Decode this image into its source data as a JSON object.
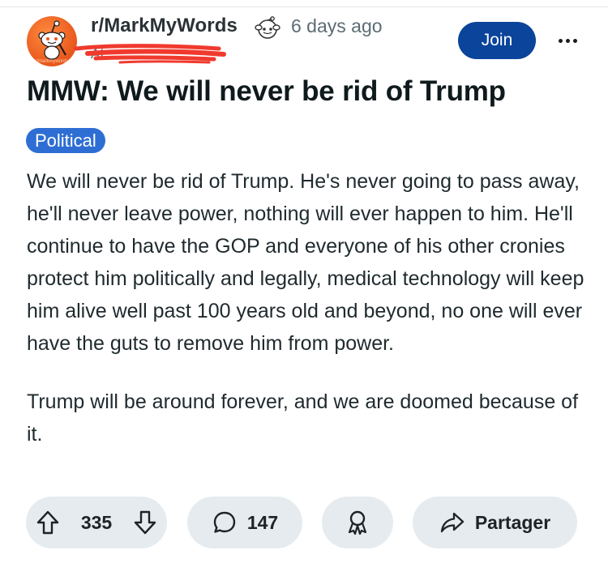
{
  "post": {
    "subreddit": "r/MarkMyWords",
    "time_ago": "6 days ago",
    "author_redacted": "AI",
    "title": "MMW: We will never be rid of Trump",
    "flair": "Political",
    "body": [
      "We will never be rid of Trump. He's never going to pass away, he'll never leave power, nothing will ever happen to him. He'll continue to have the GOP and everyone of his other cronies protect him politically and legally, medical technology will keep him alive well past 100 years old and beyond, no one will ever have the guts to remove him from power.",
      "Trump will be around forever, and we are doomed because of it."
    ]
  },
  "header": {
    "join_label": "Join",
    "avatar_caption": "r/markmywords"
  },
  "actions": {
    "upvotes": "335",
    "comments": "147",
    "share_label": "Partager"
  },
  "colors": {
    "join_bg": "#0a449b",
    "flair_bg": "#2e6ed4",
    "pill_bg": "#e5ebee",
    "avatar_orange": "#e8571d",
    "redaction_red": "#f03a2e"
  },
  "icons": [
    "snoo-avatar-icon",
    "community-badge-icon",
    "more-options-icon",
    "upvote-icon",
    "downvote-icon",
    "comment-icon",
    "award-icon",
    "share-icon"
  ]
}
